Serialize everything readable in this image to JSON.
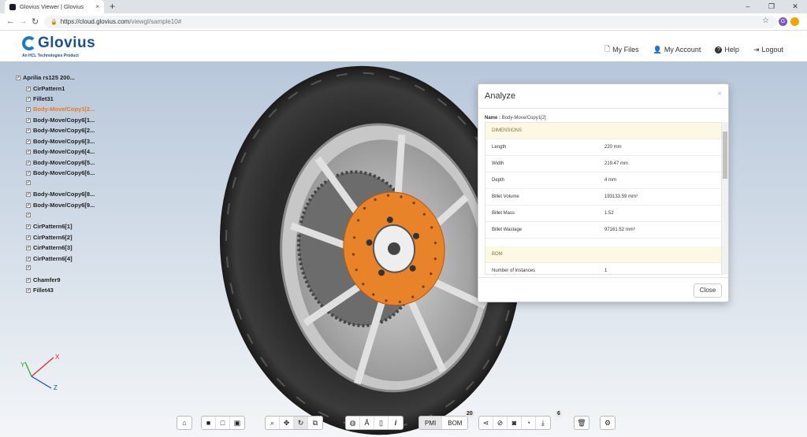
{
  "browser": {
    "tab_title": "Glovius Viewer | Glovius",
    "tab_close": "×",
    "new_tab": "+",
    "url_host": "https://cloud.glovius.com",
    "url_path": "/viewgl/sample10#",
    "win_minimize": "–",
    "win_restore": "❐",
    "win_close": "✕",
    "profile_initial": "G"
  },
  "header": {
    "logo_text": "Glovius",
    "logo_sub": "An HCL Technologies Product",
    "menu": [
      {
        "label": "My Files",
        "icon": "files-icon"
      },
      {
        "label": "My Account",
        "icon": "user-icon"
      },
      {
        "label": "Help",
        "icon": "help-icon"
      },
      {
        "label": "Logout",
        "icon": "logout-icon"
      }
    ]
  },
  "tree": {
    "root": "Aprilia rs125 200...",
    "items": [
      "CirPattern1",
      "Fillet31",
      "Body-Move/Copy1[2...",
      "Body-Move/Copy6[1...",
      "Body-Move/Copy6[2...",
      "Body-Move/Copy6[3...",
      "Body-Move/Copy6[4...",
      "Body-Move/Copy6[5...",
      "Body-Move/Copy6[6...",
      "",
      "Body-Move/Copy6[8...",
      "Body-Move/Copy6[9...",
      "",
      "CirPattern6[1]",
      "CirPattern6[2]",
      "CirPattern6[3]",
      "CirPattern6[4]",
      "",
      "Chamfer9",
      "Fillet43"
    ],
    "highlighted_index": 2
  },
  "axes": {
    "x": "X",
    "y": "Y",
    "z": "Z"
  },
  "dialog": {
    "title": "Analyze",
    "close_x": "×",
    "name_label": "Name :",
    "name_value": "Body-Move/Copy1[2]",
    "dimensions_header": "DIMENSIONS",
    "rows": [
      {
        "k": "Length",
        "v": "220 mm"
      },
      {
        "k": "Width",
        "v": "219.47 mm"
      },
      {
        "k": "Depth",
        "v": "4 mm"
      },
      {
        "k": "Billet Volume",
        "v": "193133.59 mm³"
      },
      {
        "k": "Billet Mass",
        "v": "1.52"
      },
      {
        "k": "Billet Wastage",
        "v": "97161.52 mm³"
      }
    ],
    "bom_header": "BOM",
    "bom_rows": [
      {
        "k": "Number of instances",
        "v": "1"
      }
    ],
    "close_button": "Close"
  },
  "toolbar": {
    "pmi_label": "PMI",
    "bom_label": "BOM",
    "bom_badge": "20",
    "download_badge": "6"
  },
  "colors": {
    "brand": "#1b4f91",
    "highlight": "#e67a20",
    "rotor": "#e8832a"
  }
}
